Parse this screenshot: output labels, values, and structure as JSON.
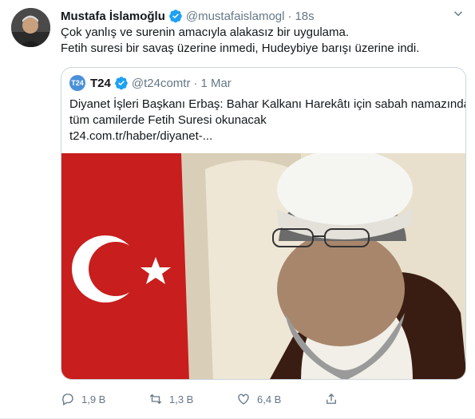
{
  "tweet": {
    "author_name": "Mustafa İslamoğlu",
    "author_handle": "@mustafaislamogl",
    "separator": "·",
    "time": "18s",
    "lines": [
      "Çok yanlış ve surenin amacıyla alakasız bir uygulama.",
      "Fetih suresi bir savaş üzerine inmedi, Hudeybiye barışı üzerine indi."
    ]
  },
  "quote": {
    "logo_text": "T24",
    "author_name": "T24",
    "author_handle": "@t24comtr",
    "separator": "·",
    "time": "1 Mar",
    "lines": [
      "Diyanet İşleri Başkanı Erbaş: Bahar Kalkanı Harekâtı için sabah namazında",
      "tüm camilerde Fetih Suresi okunacak",
      "t24.com.tr/haber/diyanet-..."
    ]
  },
  "actions": {
    "reply_count": "1,9 B",
    "retweet_count": "1,3 B",
    "like_count": "6,4 B"
  },
  "colors": {
    "secondary_text": "#657786",
    "verified_blue": "#1da1f2",
    "border": "#ccd6dd"
  }
}
